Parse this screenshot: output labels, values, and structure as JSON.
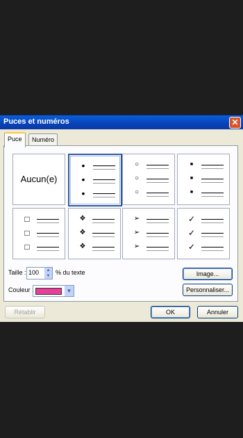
{
  "dialog": {
    "title": "Puces et numéros",
    "close_glyph": "✕"
  },
  "tabs": [
    {
      "label": "Puce"
    },
    {
      "label": "Numéro"
    }
  ],
  "bullets": {
    "none_label": "Aucun(e)",
    "symbols": [
      "•",
      "○",
      "■",
      "□",
      "❖",
      "➢",
      "✓"
    ]
  },
  "size": {
    "label": "Taille :",
    "value": "100",
    "suffix": "% du texte"
  },
  "color": {
    "label": "Couleur :",
    "value": "#e8409a"
  },
  "buttons": {
    "image": "Image...",
    "customize": "Personnaliser...",
    "reset": "Rétablir",
    "ok": "OK",
    "cancel": "Annuler"
  }
}
